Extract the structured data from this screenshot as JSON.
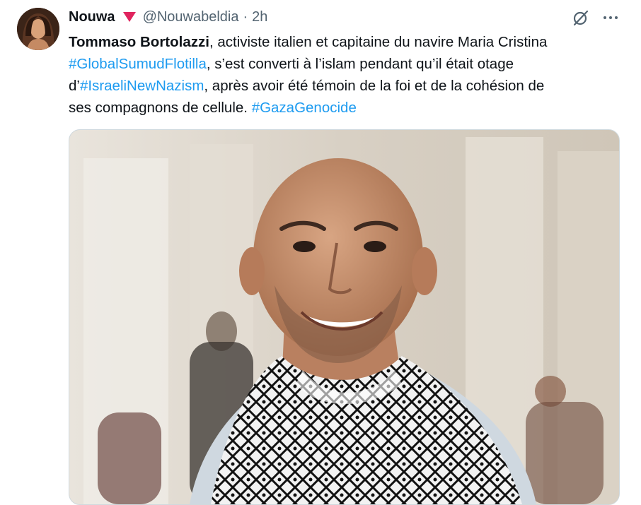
{
  "author": {
    "display_name": "Nouwa",
    "handle": "@Nouwabeldia",
    "separator": "·",
    "time": "2h",
    "badge_icon": "red-triangle-icon",
    "badge_color": "#e0245e"
  },
  "actions": {
    "grok_icon": "grok-slash-icon",
    "more_icon": "more-dots-icon"
  },
  "tweet": {
    "l1_bold": "Tommaso Bortolazzi",
    "l1_rest": ", activiste italien et capitaine du navire Maria Cristina",
    "l2_tag": "#GlobalSumudFlotilla",
    "l2_rest": ", s’est converti à l’islam pendant qu’il était otage",
    "l3_pre": "d’",
    "l3_tag": "#IsraeliNewNazism",
    "l3_rest": ", après avoir été témoin de la foi et de la cohésion de",
    "l4_pre": "ses compagnons de cellule. ",
    "l4_tag": "#GazaGenocide"
  },
  "colors": {
    "link": "#1d9bf0",
    "text": "#0f1419",
    "secondary": "#536471"
  }
}
